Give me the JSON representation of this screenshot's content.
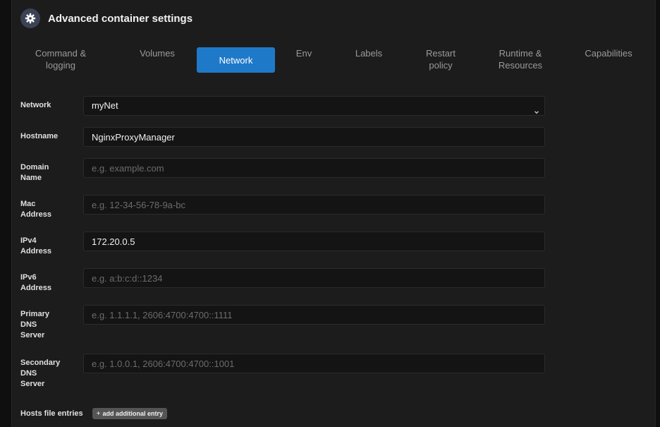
{
  "header": {
    "title": "Advanced container settings",
    "icon": "gear-icon"
  },
  "tabs": [
    {
      "line1": "Command &",
      "line2": "logging"
    },
    {
      "line1": "Volumes",
      "line2": ""
    },
    {
      "line1": "Network",
      "line2": "",
      "active": true
    },
    {
      "line1": "Env",
      "line2": ""
    },
    {
      "line1": "Labels",
      "line2": ""
    },
    {
      "line1": "Restart",
      "line2": "policy"
    },
    {
      "line1": "Runtime &",
      "line2": "Resources"
    },
    {
      "line1": "Capabilities",
      "line2": ""
    }
  ],
  "fields": {
    "network": {
      "label": "Network",
      "value": "myNet"
    },
    "hostname": {
      "label": "Hostname",
      "value": "NginxProxyManager",
      "placeholder": ""
    },
    "domain": {
      "label1": "Domain",
      "label2": "Name",
      "value": "",
      "placeholder": "e.g. example.com"
    },
    "mac": {
      "label1": "Mac",
      "label2": "Address",
      "value": "",
      "placeholder": "e.g. 12-34-56-78-9a-bc"
    },
    "ipv4": {
      "label1": "IPv4",
      "label2": "Address",
      "value": "172.20.0.5",
      "placeholder": ""
    },
    "ipv6": {
      "label1": "IPv6",
      "label2": "Address",
      "value": "",
      "placeholder": "e.g. a:b:c:d::1234"
    },
    "dns1": {
      "label1": "Primary",
      "label2": "DNS",
      "label3": "Server",
      "value": "",
      "placeholder": "e.g. 1.1.1.1, 2606:4700:4700::1111"
    },
    "dns2": {
      "label1": "Secondary",
      "label2": "DNS",
      "label3": "Server",
      "value": "",
      "placeholder": "e.g. 1.0.0.1, 2606:4700:4700::1001"
    }
  },
  "hosts": {
    "label": "Hosts file entries",
    "add_label": "add additional entry",
    "add_icon": "+"
  },
  "colors": {
    "accent": "#1f79c9",
    "background": "#1c1c1c",
    "field_bg": "#141414"
  }
}
